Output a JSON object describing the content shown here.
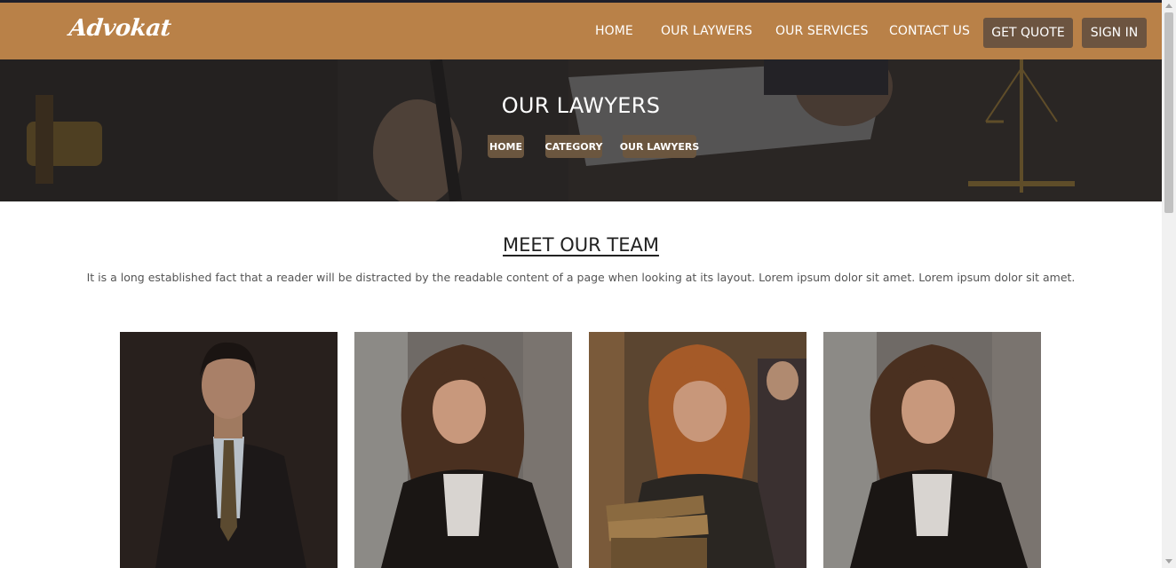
{
  "nav": {
    "logo": "Advokat",
    "links": [
      "HOME",
      "OUR LAYWERS",
      "OUR SERVICES",
      "CONTACT US"
    ],
    "get_quote": "GET QUOTE",
    "sign_in": "SIGN IN"
  },
  "hero": {
    "title": "OUR LAWYERS",
    "breadcrumbs": [
      "HOME",
      "CATEGORY",
      "OUR LAWYERS"
    ]
  },
  "team": {
    "title": "MEET OUR TEAM",
    "description": "It is a long established fact that a reader will be distracted by the readable content of a page when looking at its layout. Lorem ipsum dolor sit amet. Lorem ipsum dolor sit amet.",
    "members": [
      {
        "photo": "male-lawyer-portrait"
      },
      {
        "photo": "female-lawyer-portrait"
      },
      {
        "photo": "female-lawyer-with-books-portrait"
      },
      {
        "photo": "female-lawyer-portrait"
      }
    ]
  },
  "colors": {
    "navbar": "#b98148",
    "button": "#6c5440",
    "breadcrumb": "#6b563f"
  }
}
